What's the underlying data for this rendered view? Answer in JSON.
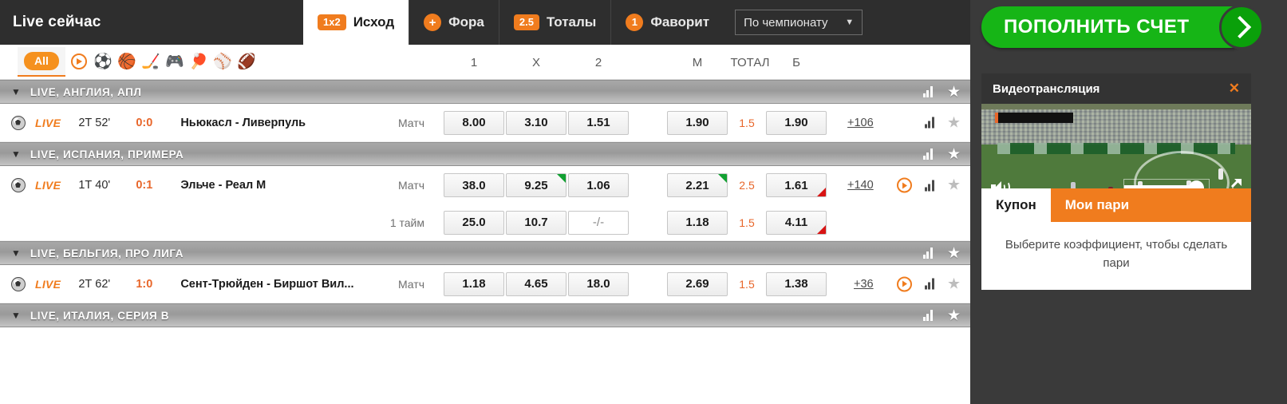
{
  "header": {
    "live_title": "Live сейчас",
    "tabs": [
      {
        "badge": "1x2",
        "badge_style": "pill",
        "label": "Исход",
        "active": true
      },
      {
        "badge": "+",
        "badge_style": "circle",
        "label": "Фора",
        "active": false
      },
      {
        "badge": "2.5",
        "badge_style": "pill",
        "label": "Тоталы",
        "active": false
      },
      {
        "badge": "1",
        "badge_style": "circle",
        "label": "Фаворит",
        "active": false
      }
    ],
    "sort_select": {
      "value": "По чемпионату",
      "icon": "chevron-down-icon"
    }
  },
  "sportbar": {
    "all_label": "All",
    "icons": [
      "play-circle-icon",
      "soccer-ball-icon",
      "basketball-icon",
      "hockey-puck-icon",
      "esports-gamepad-icon",
      "table-tennis-icon",
      "baseball-icon",
      "football-icon"
    ],
    "columns": [
      "1",
      "X",
      "2",
      "М",
      "ТОТАЛ",
      "Б"
    ]
  },
  "leagues": [
    {
      "name": "LIVE, АНГЛИЯ, АПЛ",
      "matches": [
        {
          "live_label": "LIVE",
          "time": "2Т 52'",
          "score": "0:0",
          "teams": "Ньюкасл - Ливерпуль",
          "markets": [
            {
              "label": "Матч",
              "odds": [
                {
                  "value": "8.00",
                  "trend": "none"
                },
                {
                  "value": "3.10",
                  "trend": "none"
                },
                {
                  "value": "1.51",
                  "trend": "none"
                }
              ],
              "total_over": {
                "value": "1.90",
                "trend": "none"
              },
              "total_line": "1.5",
              "total_under": {
                "value": "1.90",
                "trend": "none"
              }
            }
          ],
          "more": "+106",
          "has_stream": false
        }
      ]
    },
    {
      "name": "LIVE, ИСПАНИЯ, ПРИМЕРА",
      "matches": [
        {
          "live_label": "LIVE",
          "time": "1Т 40'",
          "score": "0:1",
          "teams": "Эльче - Реал М",
          "markets": [
            {
              "label": "Матч",
              "odds": [
                {
                  "value": "38.0",
                  "trend": "none"
                },
                {
                  "value": "9.25",
                  "trend": "up"
                },
                {
                  "value": "1.06",
                  "trend": "none"
                }
              ],
              "total_over": {
                "value": "2.21",
                "trend": "up"
              },
              "total_line": "2.5",
              "total_under": {
                "value": "1.61",
                "trend": "down"
              }
            },
            {
              "label": "1 тайм",
              "odds": [
                {
                  "value": "25.0",
                  "trend": "none"
                },
                {
                  "value": "10.7",
                  "trend": "none"
                },
                {
                  "value": "-/-",
                  "trend": "none",
                  "empty": true
                }
              ],
              "total_over": {
                "value": "1.18",
                "trend": "none"
              },
              "total_line": "1.5",
              "total_under": {
                "value": "4.11",
                "trend": "down"
              }
            }
          ],
          "more": "+140",
          "has_stream": true
        }
      ]
    },
    {
      "name": "LIVE, БЕЛЬГИЯ, ПРО ЛИГА",
      "matches": [
        {
          "live_label": "LIVE",
          "time": "2Т 62'",
          "score": "1:0",
          "teams": "Сент-Трюйден - Биршот Вил...",
          "markets": [
            {
              "label": "Матч",
              "odds": [
                {
                  "value": "1.18",
                  "trend": "none"
                },
                {
                  "value": "4.65",
                  "trend": "none"
                },
                {
                  "value": "18.0",
                  "trend": "none"
                }
              ],
              "total_over": {
                "value": "2.69",
                "trend": "none"
              },
              "total_line": "1.5",
              "total_under": {
                "value": "1.38",
                "trend": "none"
              }
            }
          ],
          "more": "+36",
          "has_stream": true
        }
      ]
    },
    {
      "name": "LIVE, ИТАЛИЯ, СЕРИЯ В",
      "matches": []
    }
  ],
  "sidebar": {
    "deposit_label": "ПОПОЛНИТЬ СЧЕТ",
    "deposit_color": "#16b516",
    "video": {
      "title": "Видеотрансляция",
      "close_icon": "close-icon",
      "volume_icon": "speaker-icon",
      "fullscreen_icon": "fullscreen-icon",
      "volume_percent": 88
    },
    "coupon": {
      "tabs": [
        {
          "label": "Купон",
          "active": true
        },
        {
          "label": "Мои пари",
          "active": false
        }
      ],
      "empty_message": "Выберите коэффициент, чтобы сделать пари"
    }
  },
  "accent_color": "#f07c1e"
}
